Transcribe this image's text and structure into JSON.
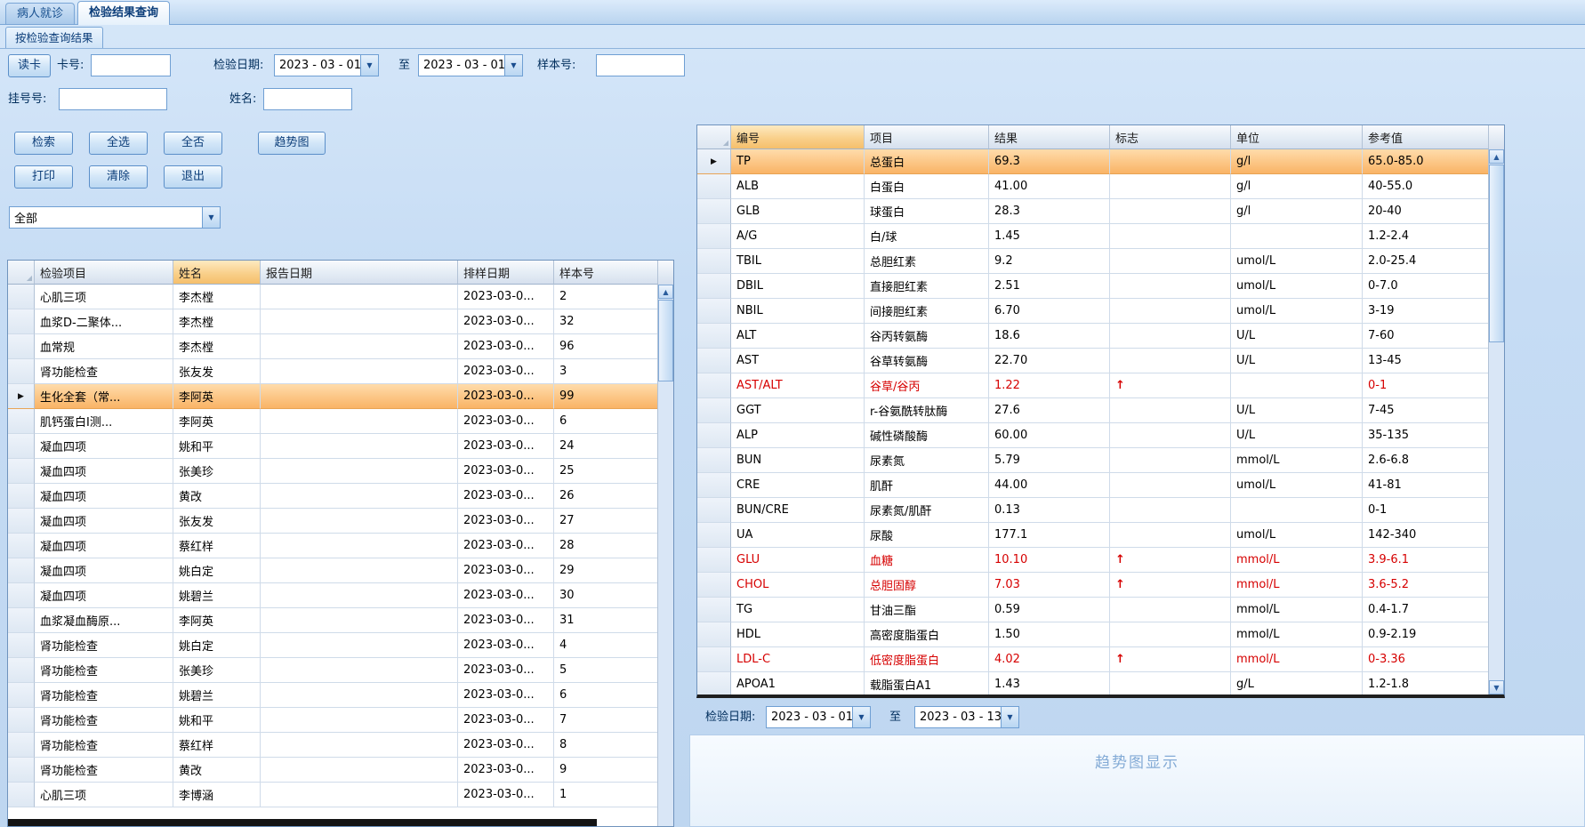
{
  "colors": {
    "accent": "#0b3d79",
    "selection": "#f9b263",
    "abnormal": "#d60000",
    "sorted_header": "#f5bf6b"
  },
  "icons": {
    "combo_arrow": "▼",
    "scroll_up": "▲",
    "scroll_down": "▼",
    "current_row": "▶",
    "select_all_corner": "◢"
  },
  "tabs": {
    "items": [
      {
        "label": "病人就诊"
      },
      {
        "label": "检验结果查询"
      }
    ]
  },
  "subtab": {
    "label": "按检验查询结果"
  },
  "filters": {
    "read_card_button": "读卡",
    "card_no": {
      "label": "卡号:",
      "value": ""
    },
    "test_date": {
      "label": "检验日期:",
      "from": "2023 - 03 - 01",
      "to_label": "至",
      "to": "2023 - 03 - 01"
    },
    "sample_no": {
      "label": "样本号:",
      "value": ""
    },
    "reg_no": {
      "label": "挂号号:",
      "value": ""
    },
    "patient_name": {
      "label": "姓名:",
      "value": ""
    }
  },
  "actions": {
    "search": "检索",
    "select_all": "全选",
    "select_none": "全否",
    "trend": "趋势图",
    "print": "打印",
    "clear": "清除",
    "exit": "退出"
  },
  "category_filter": {
    "value": "全部"
  },
  "left_grid": {
    "columns": [
      "检验项目",
      "姓名",
      "报告日期",
      "排样日期",
      "样本号"
    ],
    "sorted_column": "姓名",
    "rows": [
      {
        "item": "心肌三项",
        "name": "李杰樘",
        "report_date": "",
        "sample_date": "2023-03-0...",
        "sample_no": "2",
        "selected": false
      },
      {
        "item": "血浆D-二聚体...",
        "name": "李杰樘",
        "report_date": "",
        "sample_date": "2023-03-0...",
        "sample_no": "32",
        "selected": false
      },
      {
        "item": "血常规",
        "name": "李杰樘",
        "report_date": "",
        "sample_date": "2023-03-0...",
        "sample_no": "96",
        "selected": false
      },
      {
        "item": "肾功能检查",
        "name": "张友发",
        "report_date": "",
        "sample_date": "2023-03-0...",
        "sample_no": "3",
        "selected": false
      },
      {
        "item": "生化全套（常...",
        "name": "李阿英",
        "report_date": "",
        "sample_date": "2023-03-0...",
        "sample_no": "99",
        "selected": true
      },
      {
        "item": "肌钙蛋白I测...",
        "name": "李阿英",
        "report_date": "",
        "sample_date": "2023-03-0...",
        "sample_no": "6",
        "selected": false
      },
      {
        "item": "凝血四项",
        "name": "姚和平",
        "report_date": "",
        "sample_date": "2023-03-0...",
        "sample_no": "24",
        "selected": false
      },
      {
        "item": "凝血四项",
        "name": "张美珍",
        "report_date": "",
        "sample_date": "2023-03-0...",
        "sample_no": "25",
        "selected": false
      },
      {
        "item": "凝血四项",
        "name": "黄改",
        "report_date": "",
        "sample_date": "2023-03-0...",
        "sample_no": "26",
        "selected": false
      },
      {
        "item": "凝血四项",
        "name": "张友发",
        "report_date": "",
        "sample_date": "2023-03-0...",
        "sample_no": "27",
        "selected": false
      },
      {
        "item": "凝血四项",
        "name": "蔡红样",
        "report_date": "",
        "sample_date": "2023-03-0...",
        "sample_no": "28",
        "selected": false
      },
      {
        "item": "凝血四项",
        "name": "姚白定",
        "report_date": "",
        "sample_date": "2023-03-0...",
        "sample_no": "29",
        "selected": false
      },
      {
        "item": "凝血四项",
        "name": "姚碧兰",
        "report_date": "",
        "sample_date": "2023-03-0...",
        "sample_no": "30",
        "selected": false
      },
      {
        "item": "血浆凝血酶原...",
        "name": "李阿英",
        "report_date": "",
        "sample_date": "2023-03-0...",
        "sample_no": "31",
        "selected": false
      },
      {
        "item": "肾功能检查",
        "name": "姚白定",
        "report_date": "",
        "sample_date": "2023-03-0...",
        "sample_no": "4",
        "selected": false
      },
      {
        "item": "肾功能检查",
        "name": "张美珍",
        "report_date": "",
        "sample_date": "2023-03-0...",
        "sample_no": "5",
        "selected": false
      },
      {
        "item": "肾功能检查",
        "name": "姚碧兰",
        "report_date": "",
        "sample_date": "2023-03-0...",
        "sample_no": "6",
        "selected": false
      },
      {
        "item": "肾功能检查",
        "name": "姚和平",
        "report_date": "",
        "sample_date": "2023-03-0...",
        "sample_no": "7",
        "selected": false
      },
      {
        "item": "肾功能检查",
        "name": "蔡红样",
        "report_date": "",
        "sample_date": "2023-03-0...",
        "sample_no": "8",
        "selected": false
      },
      {
        "item": "肾功能检查",
        "name": "黄改",
        "report_date": "",
        "sample_date": "2023-03-0...",
        "sample_no": "9",
        "selected": false
      },
      {
        "item": "心肌三项",
        "name": "李博涵",
        "report_date": "",
        "sample_date": "2023-03-0...",
        "sample_no": "1",
        "selected": false
      }
    ]
  },
  "result_grid": {
    "columns": [
      "编号",
      "项目",
      "结果",
      "标志",
      "单位",
      "参考值"
    ],
    "sorted_column": "编号",
    "rows": [
      {
        "code": "TP",
        "item": "总蛋白",
        "result": "69.3",
        "flag": "",
        "unit": "g/l",
        "ref": "65.0-85.0",
        "selected": true,
        "abnormal": false
      },
      {
        "code": "ALB",
        "item": "白蛋白",
        "result": "41.00",
        "flag": "",
        "unit": "g/l",
        "ref": "40-55.0",
        "selected": false,
        "abnormal": false
      },
      {
        "code": "GLB",
        "item": "球蛋白",
        "result": "28.3",
        "flag": "",
        "unit": "g/l",
        "ref": "20-40",
        "selected": false,
        "abnormal": false
      },
      {
        "code": "A/G",
        "item": "白/球",
        "result": "1.45",
        "flag": "",
        "unit": "",
        "ref": "1.2-2.4",
        "selected": false,
        "abnormal": false
      },
      {
        "code": "TBIL",
        "item": "总胆红素",
        "result": "9.2",
        "flag": "",
        "unit": "umol/L",
        "ref": "2.0-25.4",
        "selected": false,
        "abnormal": false
      },
      {
        "code": "DBIL",
        "item": "直接胆红素",
        "result": "2.51",
        "flag": "",
        "unit": "umol/L",
        "ref": "0-7.0",
        "selected": false,
        "abnormal": false
      },
      {
        "code": "NBIL",
        "item": "间接胆红素",
        "result": "6.70",
        "flag": "",
        "unit": "umol/L",
        "ref": "3-19",
        "selected": false,
        "abnormal": false
      },
      {
        "code": "ALT",
        "item": "谷丙转氨酶",
        "result": "18.6",
        "flag": "",
        "unit": "U/L",
        "ref": "7-60",
        "selected": false,
        "abnormal": false
      },
      {
        "code": "AST",
        "item": "谷草转氨酶",
        "result": "22.70",
        "flag": "",
        "unit": "U/L",
        "ref": "13-45",
        "selected": false,
        "abnormal": false
      },
      {
        "code": "AST/ALT",
        "item": "谷草/谷丙",
        "result": "1.22",
        "flag": "↑",
        "unit": "",
        "ref": "0-1",
        "selected": false,
        "abnormal": true
      },
      {
        "code": "GGT",
        "item": "r-谷氨酰转肽酶",
        "result": "27.6",
        "flag": "",
        "unit": "U/L",
        "ref": "7-45",
        "selected": false,
        "abnormal": false
      },
      {
        "code": "ALP",
        "item": "碱性磷酸酶",
        "result": "60.00",
        "flag": "",
        "unit": "U/L",
        "ref": "35-135",
        "selected": false,
        "abnormal": false
      },
      {
        "code": "BUN",
        "item": "尿素氮",
        "result": "5.79",
        "flag": "",
        "unit": "mmol/L",
        "ref": "2.6-6.8",
        "selected": false,
        "abnormal": false
      },
      {
        "code": "CRE",
        "item": "肌酐",
        "result": "44.00",
        "flag": "",
        "unit": "umol/L",
        "ref": "41-81",
        "selected": false,
        "abnormal": false
      },
      {
        "code": "BUN/CRE",
        "item": "尿素氮/肌酐",
        "result": "0.13",
        "flag": "",
        "unit": "",
        "ref": "0-1",
        "selected": false,
        "abnormal": false
      },
      {
        "code": "UA",
        "item": "尿酸",
        "result": "177.1",
        "flag": "",
        "unit": "umol/L",
        "ref": "142-340",
        "selected": false,
        "abnormal": false
      },
      {
        "code": "GLU",
        "item": "血糖",
        "result": "10.10",
        "flag": "↑",
        "unit": "mmol/L",
        "ref": "3.9-6.1",
        "selected": false,
        "abnormal": true
      },
      {
        "code": "CHOL",
        "item": "总胆固醇",
        "result": "7.03",
        "flag": "↑",
        "unit": "mmol/L",
        "ref": "3.6-5.2",
        "selected": false,
        "abnormal": true
      },
      {
        "code": "TG",
        "item": "甘油三酯",
        "result": "0.59",
        "flag": "",
        "unit": "mmol/L",
        "ref": "0.4-1.7",
        "selected": false,
        "abnormal": false
      },
      {
        "code": "HDL",
        "item": "高密度脂蛋白",
        "result": "1.50",
        "flag": "",
        "unit": "mmol/L",
        "ref": "0.9-2.19",
        "selected": false,
        "abnormal": false
      },
      {
        "code": "LDL-C",
        "item": "低密度脂蛋白",
        "result": "4.02",
        "flag": "↑",
        "unit": "mmol/L",
        "ref": "0-3.36",
        "selected": false,
        "abnormal": true
      },
      {
        "code": "APOA1",
        "item": "载脂蛋白A1",
        "result": "1.43",
        "flag": "",
        "unit": "g/L",
        "ref": "1.2-1.8",
        "selected": false,
        "abnormal": false
      }
    ]
  },
  "trend_panel": {
    "test_date_label": "检验日期:",
    "from": "2023 - 03 - 01",
    "to_label": "至",
    "to": "2023 - 03 - 13",
    "placeholder": "趋势图显示"
  }
}
